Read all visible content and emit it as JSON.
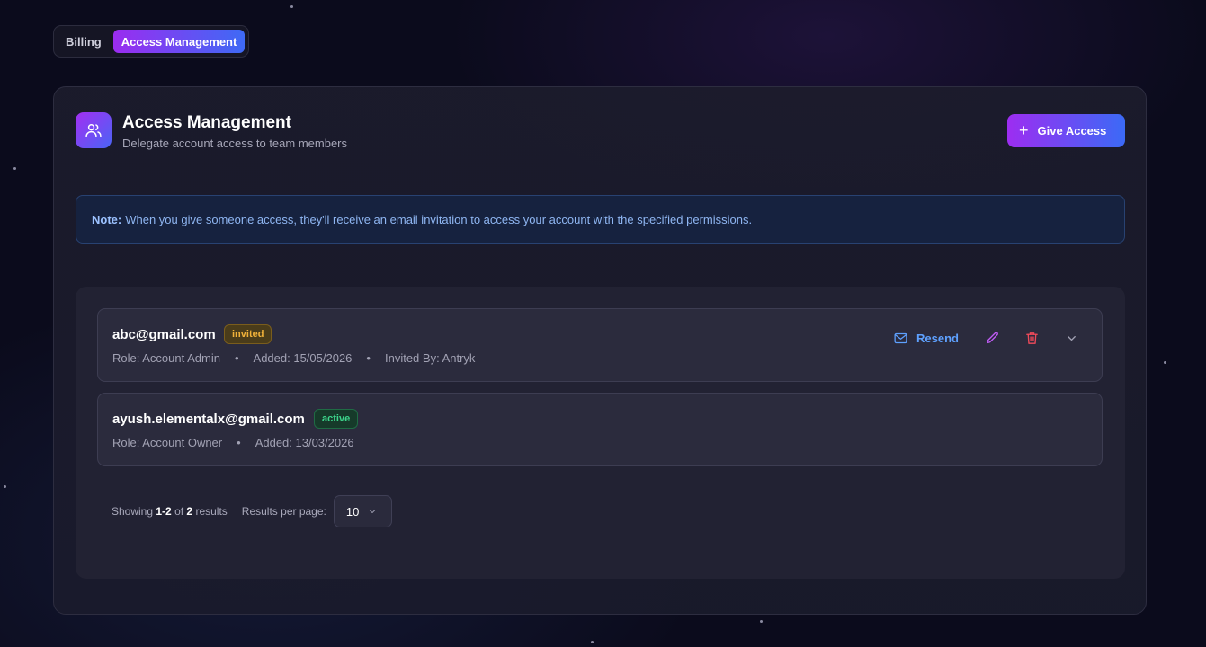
{
  "tabs": [
    {
      "label": "Billing",
      "active": false
    },
    {
      "label": "Access Management",
      "active": true
    }
  ],
  "header": {
    "icon": "users-icon",
    "title": "Access Management",
    "subtitle": "Delegate account access to team members",
    "give_access_label": "Give Access"
  },
  "note": {
    "label": "Note:",
    "text": "When you give someone access, they'll receive an email invitation to access your account with the specified permissions."
  },
  "members": [
    {
      "email": "abc@gmail.com",
      "status": "invited",
      "role": "Role: Account Admin",
      "added": "Added: 15/05/2026",
      "invited_by": "Invited By: Antryk",
      "resend_label": "Resend"
    },
    {
      "email": "ayush.elementalx@gmail.com",
      "status": "active",
      "role": "Role: Account Owner",
      "added": "Added: 13/03/2026"
    }
  ],
  "pagination": {
    "showing_prefix": "Showing",
    "range": "1-2",
    "of_label": "of",
    "total": "2",
    "results_label": "results",
    "per_page_label": "Results per page:",
    "per_page_value": "10"
  },
  "colors": {
    "accent_start": "#9b2cf0",
    "accent_end": "#3e6af5",
    "invited": "#f1b23a",
    "active": "#3dd68c",
    "resend": "#5ea1ff",
    "edit": "#c05cf5",
    "delete": "#f04a5a"
  }
}
